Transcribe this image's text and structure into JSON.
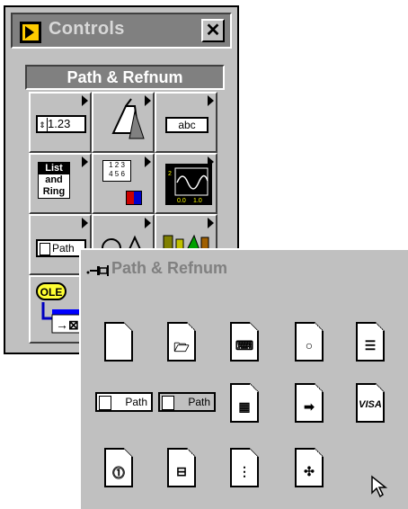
{
  "controls_window": {
    "title": "Controls",
    "close_label": "✕",
    "header": "Path & Refnum",
    "cells": {
      "numeric": "1.23",
      "string": "abc",
      "list": [
        "List",
        "and",
        "Ring"
      ],
      "array": [
        "1 2 3",
        "4 5 6"
      ],
      "path": "Path",
      "ole": "OLE"
    }
  },
  "subpalette": {
    "title": "Path & Refnum",
    "path_labels": [
      "Path",
      "Path"
    ],
    "visa_label": "VISA"
  }
}
